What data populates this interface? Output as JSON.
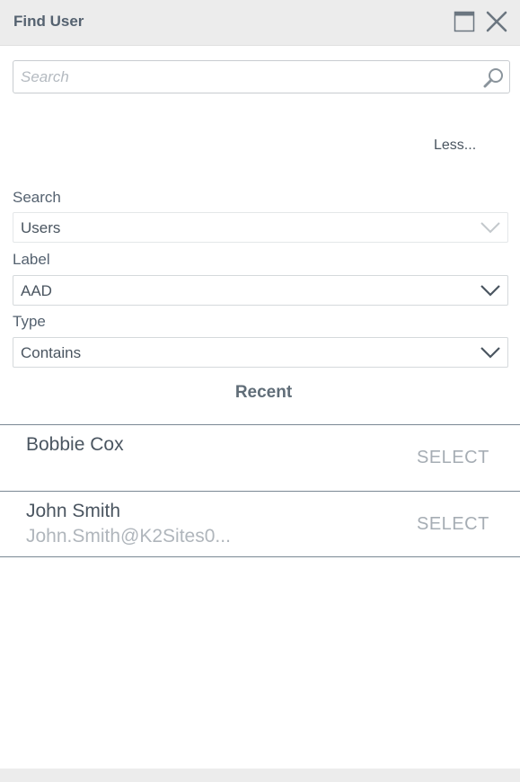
{
  "dialog": {
    "title": "Find User"
  },
  "search": {
    "placeholder": "Search",
    "value": ""
  },
  "toggle": {
    "less_label": "Less..."
  },
  "filters": {
    "search": {
      "label": "Search",
      "value": "Users"
    },
    "label": {
      "label": "Label",
      "value": "AAD"
    },
    "type": {
      "label": "Type",
      "value": "Contains"
    }
  },
  "recent": {
    "heading": "Recent",
    "users": [
      {
        "name": "Bobbie Cox",
        "email": "",
        "action": "SELECT"
      },
      {
        "name": "John Smith",
        "email": "John.Smith@K2Sites0...",
        "action": "SELECT"
      }
    ]
  },
  "icons": {
    "maximize": "maximize-icon",
    "close": "close-icon",
    "search": "search-icon",
    "chevron": "chevron-down-icon"
  },
  "colors": {
    "titlebar": "#ececec",
    "text": "#4a5560",
    "muted": "#b0b6bc",
    "divider": "#7a8894"
  }
}
